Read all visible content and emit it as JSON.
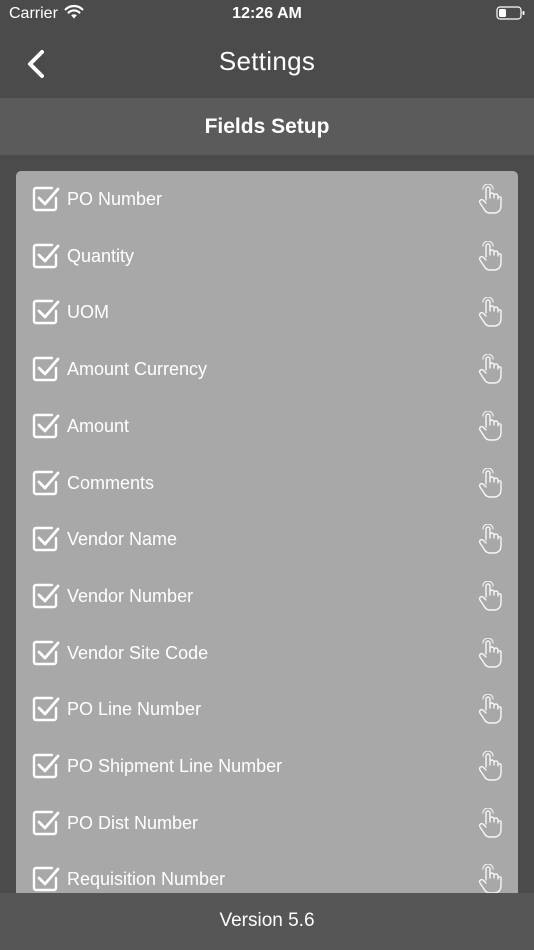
{
  "status_bar": {
    "carrier": "Carrier",
    "time": "12:26 AM"
  },
  "nav": {
    "title": "Settings",
    "back_icon": "chevron-left-icon"
  },
  "section": {
    "title": "Fields Setup"
  },
  "fields": [
    {
      "label": "PO Number",
      "checked": true
    },
    {
      "label": "Quantity",
      "checked": true
    },
    {
      "label": "UOM",
      "checked": true
    },
    {
      "label": "Amount Currency",
      "checked": true
    },
    {
      "label": "Amount",
      "checked": true
    },
    {
      "label": "Comments",
      "checked": true
    },
    {
      "label": "Vendor Name",
      "checked": true
    },
    {
      "label": "Vendor Number",
      "checked": true
    },
    {
      "label": "Vendor Site Code",
      "checked": true
    },
    {
      "label": "PO Line Number",
      "checked": true
    },
    {
      "label": "PO Shipment Line Number",
      "checked": true
    },
    {
      "label": "PO Dist Number",
      "checked": true
    },
    {
      "label": "Requisition Number",
      "checked": true
    }
  ],
  "footer": {
    "version": "Version 5.6"
  },
  "colors": {
    "background": "#4b4b4b",
    "header_bar": "#5b5b5b",
    "panel": "#a8a8a8",
    "footer": "#565656",
    "text": "#ffffff"
  }
}
